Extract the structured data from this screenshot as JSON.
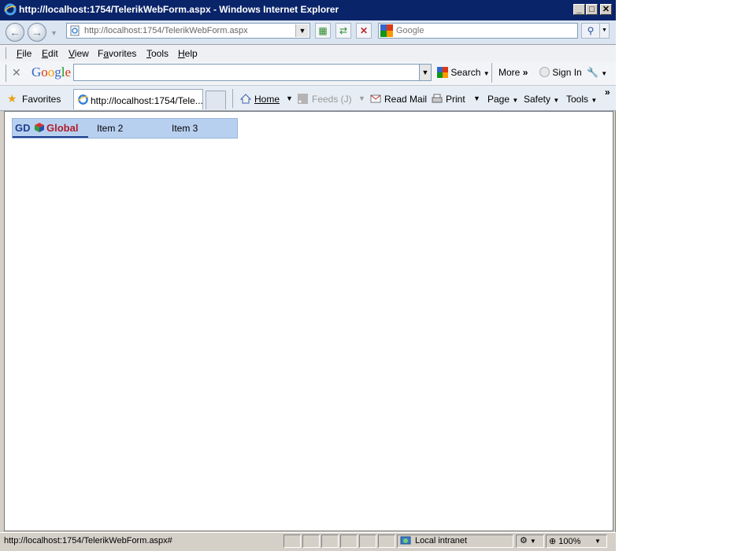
{
  "window": {
    "title": "http://localhost:1754/TelerikWebForm.aspx - Windows Internet Explorer",
    "controls": [
      "minimize",
      "maximize",
      "close"
    ]
  },
  "address_bar": {
    "url": "http://localhost:1754/TelerikWebForm.aspx",
    "search_placeholder": "Google"
  },
  "menu": {
    "items": [
      {
        "label": "File",
        "accel": "F"
      },
      {
        "label": "Edit",
        "accel": "E"
      },
      {
        "label": "View",
        "accel": "V"
      },
      {
        "label": "Favorites",
        "accel": "a"
      },
      {
        "label": "Tools",
        "accel": "T"
      },
      {
        "label": "Help",
        "accel": "H"
      }
    ]
  },
  "google_toolbar": {
    "logo": "Google",
    "search_label": "Search",
    "more_label": "More",
    "sign_in_label": "Sign In"
  },
  "favorites_bar": {
    "favorites_label": "Favorites",
    "tab_title": "http://localhost:1754/Tele...",
    "commands": {
      "home": "Home",
      "feeds": "Feeds (J)",
      "read_mail": "Read Mail",
      "print": "Print",
      "page": "Page",
      "safety": "Safety",
      "tools": "Tools"
    }
  },
  "page": {
    "logo_left": "GD",
    "logo_right": "Global",
    "menu_items": [
      "Item 2",
      "Item 3"
    ]
  },
  "status_bar": {
    "text": "http://localhost:1754/TelerikWebForm.aspx#",
    "zone": "Local intranet",
    "zoom": "100%"
  },
  "colors": {
    "title_bar": "#0a246a",
    "menu_strip": "#b8d0f0",
    "logo_blue": "#1f3f8f",
    "logo_red": "#b01e2a"
  }
}
